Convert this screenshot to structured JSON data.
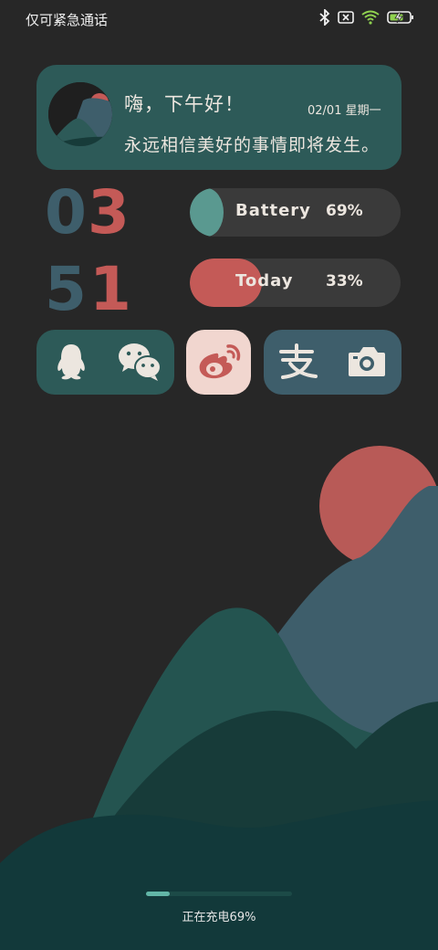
{
  "status_bar": {
    "text": "仅可紧急通话",
    "icons": [
      "bluetooth-icon",
      "no-sim-icon",
      "wifi-icon",
      "battery-charging-icon"
    ]
  },
  "greeting": {
    "title": "嗨，下午好！",
    "date": "02/01 星期一",
    "message": "永远相信美好的事情即将发生。"
  },
  "clock": {
    "hour_tens": "0",
    "hour_ones": "3",
    "minute_tens": "5",
    "minute_ones": "1"
  },
  "battery_pill": {
    "label": "Battery",
    "value": "69%",
    "level": 0.69
  },
  "today_pill": {
    "label": "Today",
    "value": "33%",
    "level": 0.33
  },
  "apps": [
    "qq-icon",
    "wechat-icon",
    "weibo-icon",
    "alipay-icon",
    "camera-icon"
  ],
  "charging": {
    "text": "正在充电69%",
    "level": 0.69
  },
  "colors": {
    "background": "#272727",
    "teal": "#2d5a58",
    "slate": "#3e5e6b",
    "red": "#c45a57",
    "pale_teal": "#5a9990",
    "cream": "#e9e4df",
    "pink": "#f1d6cf"
  }
}
